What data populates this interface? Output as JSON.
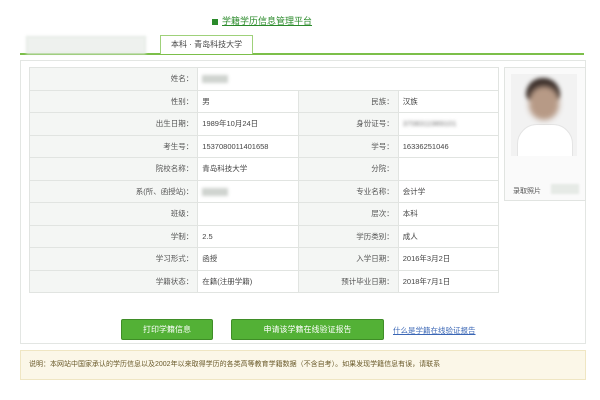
{
  "header": {
    "link_text": "学籍学历信息管理平台"
  },
  "tabs": {
    "active_label": "本科 · 青岛科技大学"
  },
  "profile": {
    "rows": [
      [
        {
          "label": "姓名：",
          "value": "",
          "blurred": true,
          "colspan": 3
        }
      ],
      [
        {
          "label": "性别：",
          "value": "男"
        },
        {
          "label": "民族：",
          "value": "汉族"
        }
      ],
      [
        {
          "label": "出生日期：",
          "value": "1989年10月24日"
        },
        {
          "label": "身份证号：",
          "value": "3708311989101",
          "blurred": true
        }
      ],
      [
        {
          "label": "考生号：",
          "value": "15370800114016​58"
        },
        {
          "label": "学号：",
          "value": "16336251046"
        }
      ],
      [
        {
          "label": "院校名称：",
          "value": "青岛科技大学"
        },
        {
          "label": "分院：",
          "value": ""
        }
      ],
      [
        {
          "label": "系(所、函授站)：",
          "value": "",
          "blurred": true
        },
        {
          "label": "专业名称：",
          "value": "会计学"
        }
      ],
      [
        {
          "label": "班级：",
          "value": ""
        },
        {
          "label": "层次：",
          "value": "本科"
        }
      ],
      [
        {
          "label": "学制：",
          "value": "2.5"
        },
        {
          "label": "学历类别：",
          "value": "成人"
        }
      ],
      [
        {
          "label": "学习形式：",
          "value": "函授"
        },
        {
          "label": "入学日期：",
          "value": "2016年3月2日"
        }
      ],
      [
        {
          "label": "学籍状态：",
          "value": "在籍(注册学籍)"
        },
        {
          "label": "预计毕业日期：",
          "value": "2018年7月1日"
        }
      ]
    ]
  },
  "photo": {
    "label": "录取照片"
  },
  "actions": {
    "print_label": "打印学籍信息",
    "apply_label": "申请该学籍在线验证报告",
    "link_label": "什么是学籍在线验证报告"
  },
  "notice": {
    "text": "说明：本网站中国家承认的学历信息以及2002年以来取得学历的各类高等教育学籍数据（不含自考）。如果发现学籍信息有误，请联系"
  },
  "colors": {
    "accent_green": "#53b136",
    "tab_border": "#7cbf4a",
    "link_blue": "#3a66b5"
  }
}
